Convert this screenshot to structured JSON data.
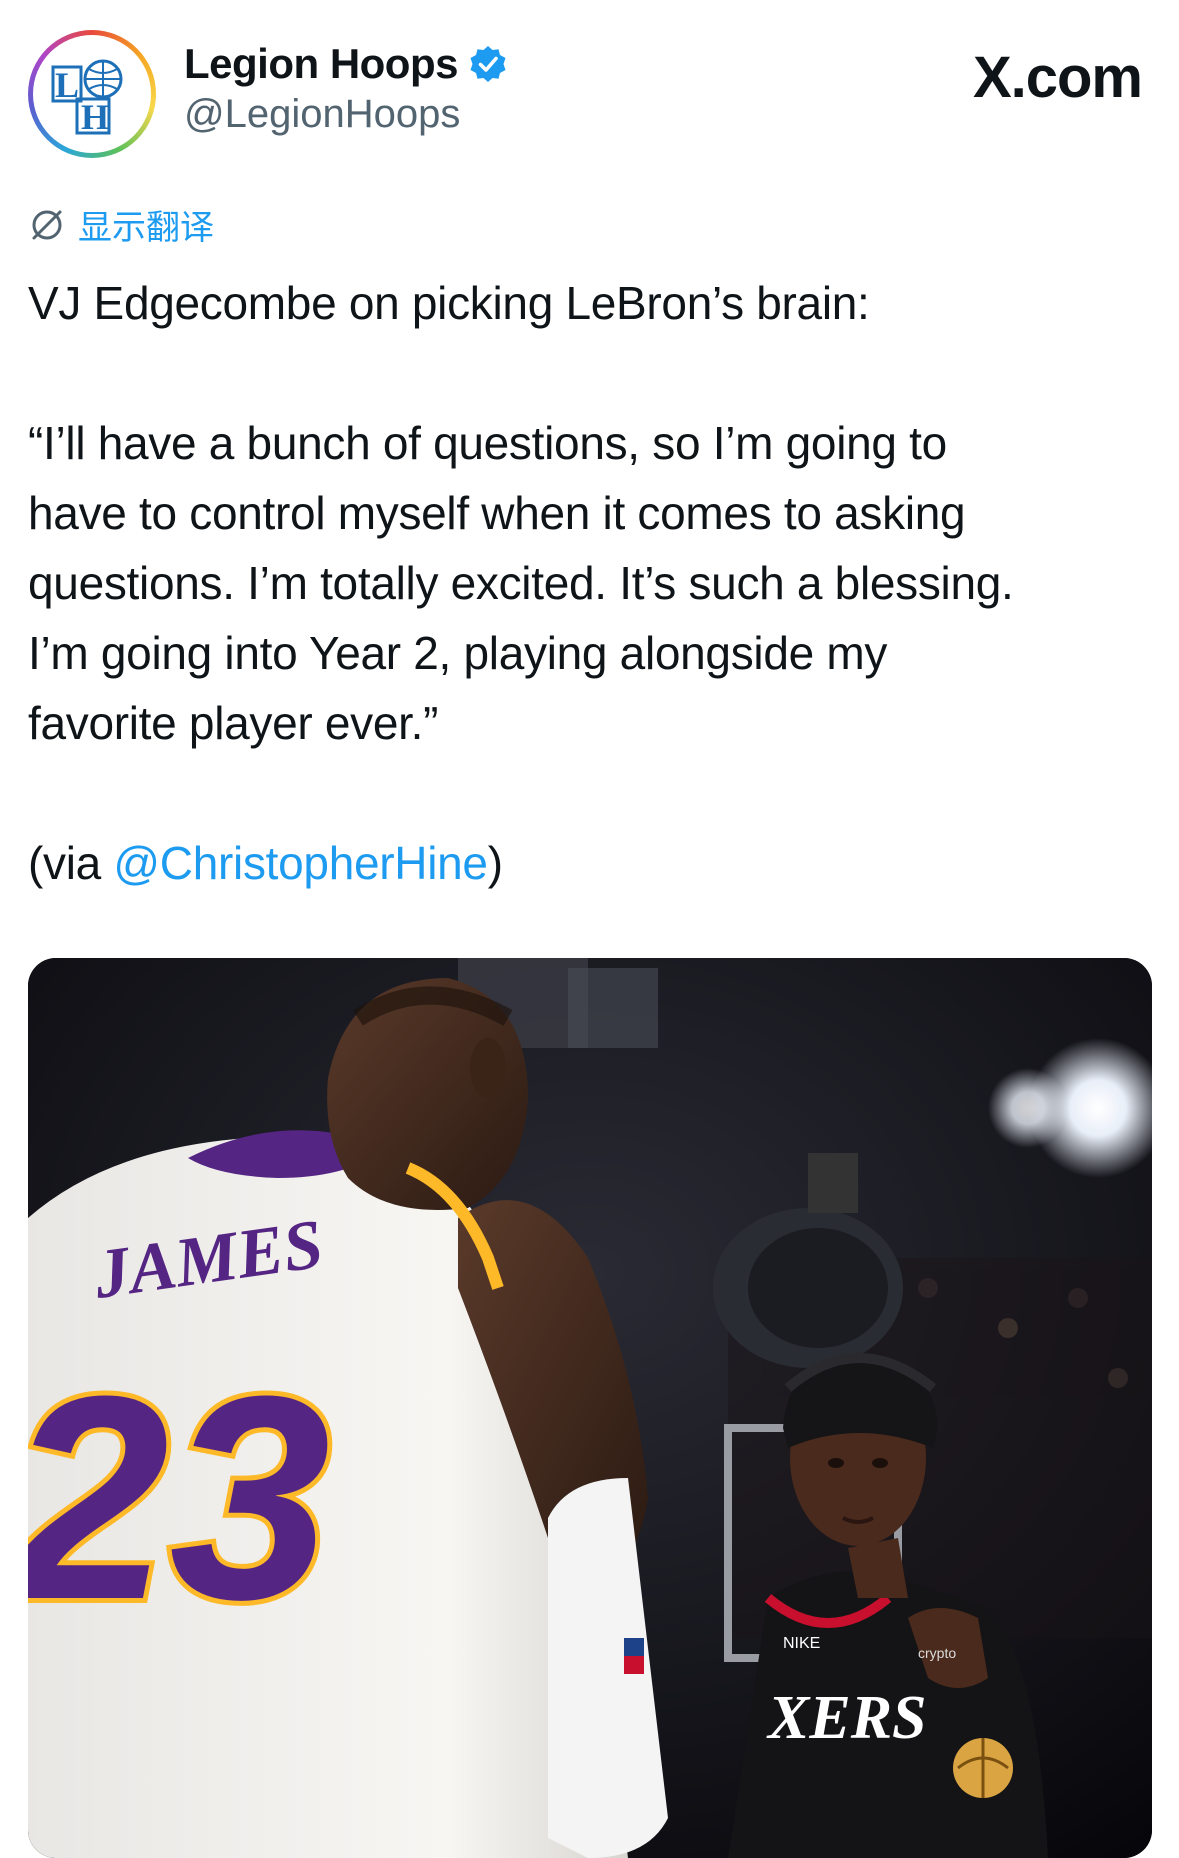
{
  "header": {
    "display_name": "Legion Hoops",
    "handle": "@LegionHoops",
    "verified_icon": "verified-badge-icon",
    "brand": "X.com",
    "avatar_text": "LH"
  },
  "translate": {
    "icon": "globe-icon",
    "label": "显示翻译"
  },
  "tweet": {
    "line1": "VJ Edgecombe on picking LeBron’s brain:",
    "quote_lines": [
      "“I’ll have a bunch of questions, so I’m going to",
      "have to control myself when it comes to asking",
      "questions. I’m totally excited. It’s such a blessing.",
      "I’m going into Year 2, playing alongside my",
      "favorite player ever.”"
    ],
    "via_prefix": "(via ",
    "via_mention": "@ChristopherHine",
    "via_suffix": ")"
  },
  "media": {
    "jersey_name": "JAMES",
    "jersey_number": "23",
    "jersey_right_text": "XERS",
    "sponsor_text": "crypto",
    "brand_mark": "NIKE"
  },
  "colors": {
    "accent": "#1d9bf0",
    "text": "#0f1419",
    "secondary": "#536471",
    "lakers_purple": "#552583",
    "lakers_gold": "#fdb927"
  }
}
